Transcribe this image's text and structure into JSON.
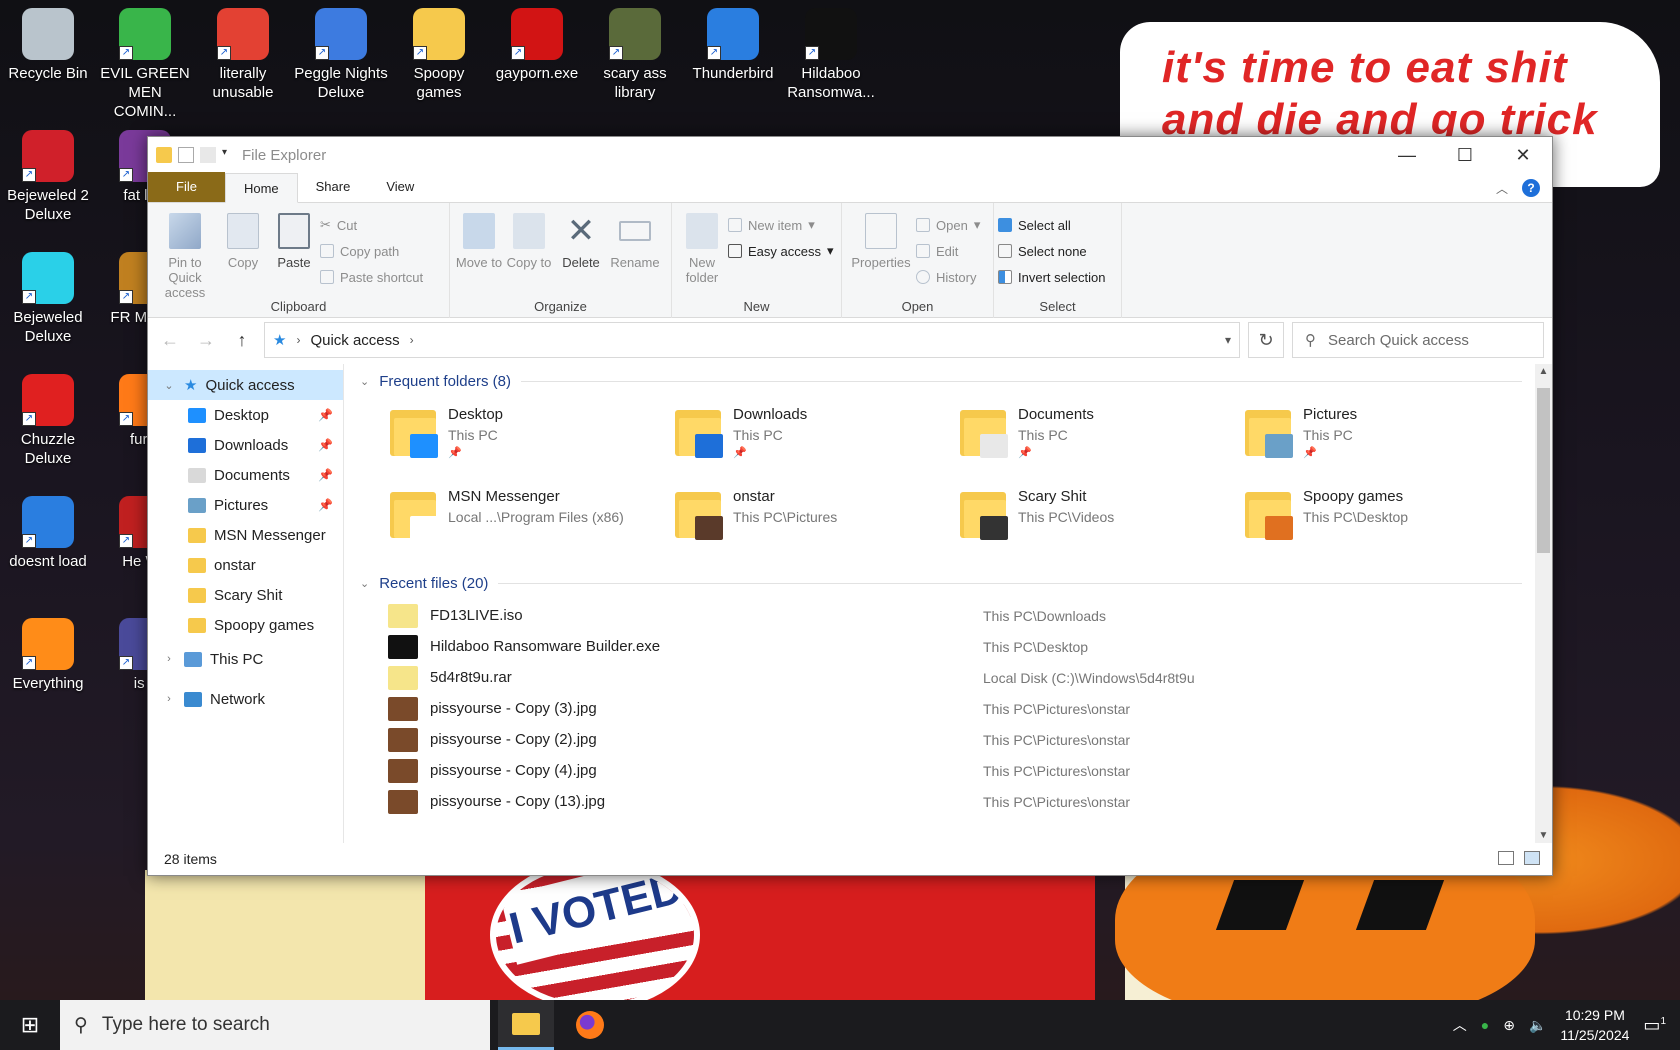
{
  "desktop": {
    "meme_text": "it's time to eat shit and die and go trick",
    "voted_text": "I VOTED",
    "icons": [
      {
        "label": "Recycle Bin",
        "icon": "recycle-bin-icon",
        "color": "#b9c4cc"
      },
      {
        "label": "EVIL GREEN MEN COMIN...",
        "icon": "msn-people-icon",
        "color": "#39b54a"
      },
      {
        "label": "literally unusable",
        "icon": "chrome-icon",
        "color": "#e34133"
      },
      {
        "label": "Peggle Nights Deluxe",
        "icon": "peggle-icon",
        "color": "#3d7be0"
      },
      {
        "label": "Spoopy games",
        "icon": "folder-icon",
        "color": "#f6c94c"
      },
      {
        "label": "gayporn.exe",
        "icon": "flash-icon",
        "color": "#d21414"
      },
      {
        "label": "scary ass library",
        "icon": "library-icon",
        "color": "#5a6a3a"
      },
      {
        "label": "Thunderbird",
        "icon": "thunderbird-icon",
        "color": "#2a7ee0"
      },
      {
        "label": "Hildaboo Ransomwa...",
        "icon": "yashma-icon",
        "color": "#111111"
      },
      {
        "label": "Bejeweled 2 Deluxe",
        "icon": "bejeweled2-icon",
        "color": "#d0202a"
      },
      {
        "label": "fat like",
        "icon": "game-icon",
        "color": "#7a3a9a"
      },
      {
        "label": "Bejeweled Deluxe",
        "icon": "bejeweled-icon",
        "color": "#2ad0e8"
      },
      {
        "label": "FR MONE",
        "icon": "money-icon",
        "color": "#c08020"
      },
      {
        "label": "Chuzzle Deluxe",
        "icon": "chuzzle-icon",
        "color": "#e02020"
      },
      {
        "label": "furry",
        "icon": "firefox-icon",
        "color": "#ff7a18"
      },
      {
        "label": "doesnt load",
        "icon": "thunderbird-icon",
        "color": "#2a7ee0"
      },
      {
        "label": "He We",
        "icon": "game-icon",
        "color": "#c02020"
      },
      {
        "label": "Everything",
        "icon": "everything-search-icon",
        "color": "#ff8c18"
      },
      {
        "label": "is v",
        "icon": "game-icon",
        "color": "#4a4a9a"
      }
    ]
  },
  "window": {
    "title": "File Explorer",
    "tabs": {
      "file": "File",
      "home": "Home",
      "share": "Share",
      "view": "View"
    },
    "ribbon": {
      "clipboard": {
        "name": "Clipboard",
        "pin": "Pin to Quick access",
        "copy": "Copy",
        "paste": "Paste",
        "cut": "Cut",
        "copy_path": "Copy path",
        "paste_shortcut": "Paste shortcut"
      },
      "organize": {
        "name": "Organize",
        "move_to": "Move to",
        "copy_to": "Copy to",
        "delete": "Delete",
        "rename": "Rename"
      },
      "new": {
        "name": "New",
        "new_folder": "New folder",
        "new_item": "New item",
        "easy_access": "Easy access"
      },
      "open": {
        "name": "Open",
        "properties": "Properties",
        "open": "Open",
        "edit": "Edit",
        "history": "History"
      },
      "select": {
        "name": "Select",
        "select_all": "Select all",
        "select_none": "Select none",
        "invert": "Invert selection"
      }
    },
    "address": {
      "location": "Quick access",
      "search_placeholder": "Search Quick access"
    },
    "nav": {
      "quick_access": "Quick access",
      "pinned": [
        {
          "label": "Desktop",
          "icon": "desktop-icon",
          "color": "#1e90ff",
          "pinned": true
        },
        {
          "label": "Downloads",
          "icon": "download-arrow-icon",
          "color": "#1e6fd9",
          "pinned": true
        },
        {
          "label": "Documents",
          "icon": "documents-icon",
          "color": "#d9d9d9",
          "pinned": true
        },
        {
          "label": "Pictures",
          "icon": "pictures-icon",
          "color": "#6aa0c8",
          "pinned": true
        },
        {
          "label": "MSN Messenger",
          "icon": "folder-icon",
          "color": "#f6c94c",
          "pinned": false
        },
        {
          "label": "onstar",
          "icon": "folder-icon",
          "color": "#f6c94c",
          "pinned": false
        },
        {
          "label": "Scary Shit",
          "icon": "folder-icon",
          "color": "#f6c94c",
          "pinned": false
        },
        {
          "label": "Spoopy games",
          "icon": "folder-icon",
          "color": "#f6c94c",
          "pinned": false
        }
      ],
      "this_pc": "This PC",
      "network": "Network"
    },
    "frequent": {
      "header": "Frequent folders (8)",
      "items": [
        {
          "name": "Desktop",
          "loc": "This PC",
          "pinned": true,
          "overlay": "#1e90ff"
        },
        {
          "name": "Downloads",
          "loc": "This PC",
          "pinned": true,
          "overlay": "#1e6fd9"
        },
        {
          "name": "Documents",
          "loc": "This PC",
          "pinned": true,
          "overlay": "#e8e8e8"
        },
        {
          "name": "Pictures",
          "loc": "This PC",
          "pinned": true,
          "overlay": "#6aa0c8"
        },
        {
          "name": "MSN Messenger",
          "loc": "Local ...\\Program Files (x86)",
          "pinned": false,
          "overlay": "#ffffff"
        },
        {
          "name": "onstar",
          "loc": "This PC\\Pictures",
          "pinned": false,
          "overlay": "#5a3a2a"
        },
        {
          "name": "Scary Shit",
          "loc": "This PC\\Videos",
          "pinned": false,
          "overlay": "#333333"
        },
        {
          "name": "Spoopy games",
          "loc": "This PC\\Desktop",
          "pinned": false,
          "overlay": "#e07020"
        }
      ]
    },
    "recent": {
      "header": "Recent files (20)",
      "items": [
        {
          "name": "FD13LIVE.iso",
          "loc": "This PC\\Downloads",
          "icon": "iso-icon",
          "color": "#f6e58a"
        },
        {
          "name": "Hildaboo Ransomware Builder.exe",
          "loc": "This PC\\Desktop",
          "icon": "exe-icon",
          "color": "#111111"
        },
        {
          "name": "5d4r8t9u.rar",
          "loc": "Local Disk (C:)\\Windows\\5d4r8t9u",
          "icon": "rar-icon",
          "color": "#f6e58a"
        },
        {
          "name": "pissyourse - Copy (3).jpg",
          "loc": "This PC\\Pictures\\onstar",
          "icon": "image-icon",
          "color": "#7a4a2a"
        },
        {
          "name": "pissyourse - Copy (2).jpg",
          "loc": "This PC\\Pictures\\onstar",
          "icon": "image-icon",
          "color": "#7a4a2a"
        },
        {
          "name": "pissyourse - Copy (4).jpg",
          "loc": "This PC\\Pictures\\onstar",
          "icon": "image-icon",
          "color": "#7a4a2a"
        },
        {
          "name": "pissyourse - Copy (13).jpg",
          "loc": "This PC\\Pictures\\onstar",
          "icon": "image-icon",
          "color": "#7a4a2a"
        }
      ]
    },
    "status": "28 items"
  },
  "taskbar": {
    "search_placeholder": "Type here to search",
    "time": "10:29 PM",
    "date": "11/25/2024",
    "notif_count": "1"
  }
}
